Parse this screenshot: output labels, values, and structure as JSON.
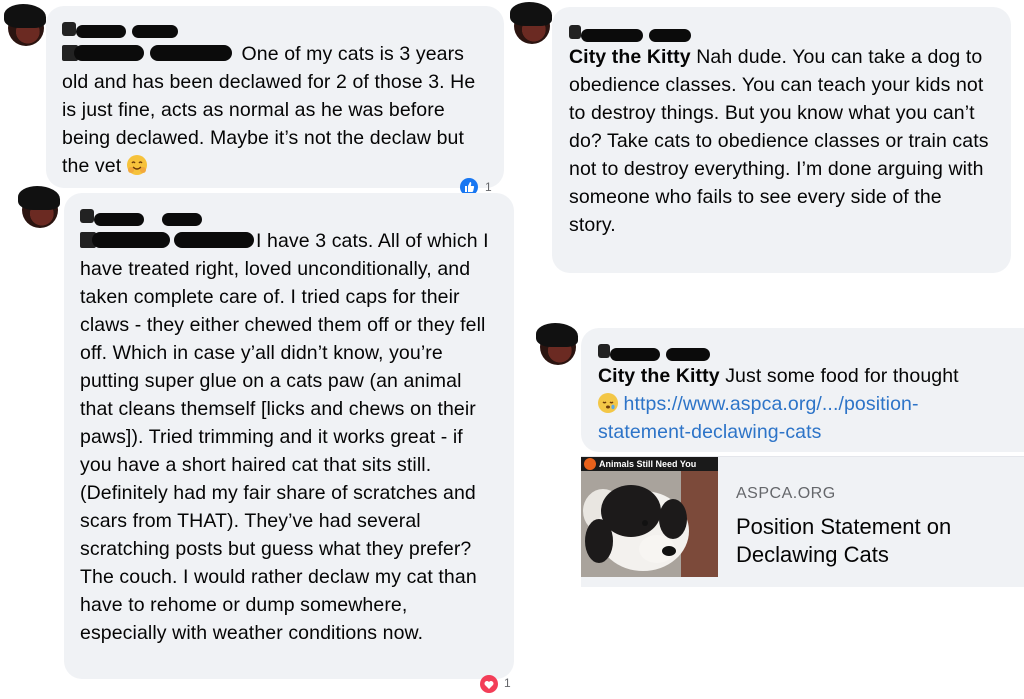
{
  "comments": [
    {
      "id": "c1",
      "reply_to": "",
      "text": "One of my cats is 3 years old and has been declawed for 2 of those 3. He is just fine, acts as normal as he was before being declawed. Maybe it’s not the declaw but the vet",
      "emoji": "hugging-face",
      "reaction_icon": "like-icon",
      "reaction_count": "1"
    },
    {
      "id": "c2",
      "reply_to": "",
      "text": "I have 3 cats. All of which I have treated right, loved unconditionally, and taken complete care of. I tried caps for their claws - they either chewed them off or they fell off. Which in case y’all didn’t know, you’re putting super glue on a cats paw (an animal that cleans themself [licks and chews on their paws]). Tried trimming and it works great - if you have a short haired cat that sits still. (Definitely had my fair share of scratches and scars from THAT). They’ve had several scratching posts but guess what they prefer? The couch. I would rather declaw my cat than have to rehome or dump somewhere, especially with weather conditions now.",
      "reaction_icon": "love-icon",
      "reaction_count": "1"
    },
    {
      "id": "c3",
      "reply_to": "City the Kitty",
      "text": "Nah dude. You can take a dog to obedience classes. You can teach your kids not to destroy things. But you know what you can’t do? Take cats to obedience classes or train cats not to destroy everything. I’m done arguing with someone who fails to see every side of the story."
    },
    {
      "id": "c4",
      "reply_to": "City the Kitty",
      "text": "Just some food for thought",
      "emoji": "sleepy-face",
      "link_text": "https://www.aspca.org/.../position-statement-declawing-cats"
    }
  ],
  "link_preview": {
    "banner_text": "Animals Still Need You",
    "domain": "ASPCA.ORG",
    "title": "Position Statement on Declawing Cats"
  },
  "colors": {
    "bubble": "#f0f2f5",
    "link": "#2d74c8",
    "like": "#1877f2",
    "love": "#f33e58"
  }
}
